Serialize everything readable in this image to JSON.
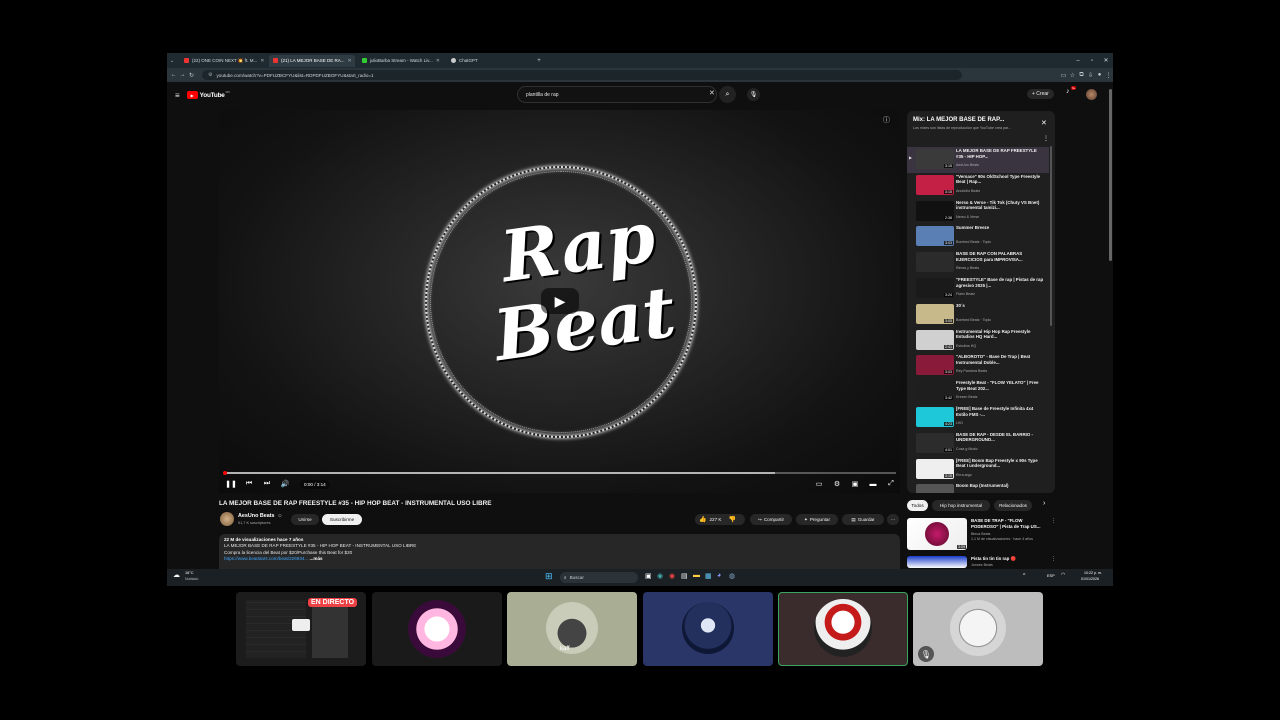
{
  "browser": {
    "tabs": [
      {
        "label": "(22) ONE COIN NEXT 💥 ft. M...",
        "color": "#e33"
      },
      {
        "label": "(21) LA MEJOR BASE DE RA...",
        "color": "#e33"
      },
      {
        "label": "julioBarba Stream - Watch Liv...",
        "color": "#3c3"
      },
      {
        "label": "ChatGPT",
        "color": "#ccc"
      }
    ],
    "new_tab": "+",
    "url": "youtube.com/watch?v=PDFUZBCFYU&list=RDPDFUZBOFYU&start_radio=1",
    "win_min": "–",
    "win_max": "▫",
    "win_close": "✕"
  },
  "youtube": {
    "logo": "YouTube",
    "logo_region": "MX",
    "search_value": "plantilla de rap",
    "create_label": "+ Crear",
    "notif_count": "9+"
  },
  "player": {
    "art_word1": "Rap",
    "art_word2": "Beat",
    "time": "0:00 / 3:14",
    "progress": 0.82
  },
  "video": {
    "title": "LA MEJOR BASE DE RAP FREESTYLE #35 - HIP HOP BEAT - INSTRUMENTAL USO LIBRE",
    "channel": "AesUno Beats",
    "subscribers": "51,7 K suscriptores",
    "join": "Unirse",
    "subscribe": "Suscribirme",
    "likes": "227 K",
    "share": "Compartir",
    "ask": "Preguntar",
    "save": "Guardar",
    "more": "···",
    "desc_stats": "22 M de visualizaciones  hace 7 años",
    "desc_line1": "LA MEJOR BASE DE RAP FREESTYLE #35 - HIP HOP BEAT - INSTRUMENTAL USO LIBRE",
    "desc_line2": "Compra la licencia del Beat por $20/Purchase this Beat for $20",
    "desc_link": "https://www.beatstars.com/beat/226934...",
    "desc_more": "...más"
  },
  "playlist": {
    "title": "Mix: LA MEJOR BASE DE RAP...",
    "subtitle": "Los mixes son listas de reproducción que YouTube crea par...",
    "close": "✕",
    "items": [
      {
        "title": "LA MEJOR BASE DE RAP FREESTYLE #35 - HIP HOP...",
        "channel": "AesUno Beats",
        "dur": "3:15",
        "color": "#3a3a3a"
      },
      {
        "title": "\"Versace\" 90s OldSchool Type Freestyle Beat | Rap...",
        "channel": "Anubidio Beatz",
        "dur": "3:15",
        "color": "#c42045"
      },
      {
        "title": "Nerso & Verse - Tik Tok (Chuty VS Bnet) instrumental tamizi...",
        "channel": "Nerso & Verse",
        "dur": "2:38",
        "color": "#111"
      },
      {
        "title": "Summer Breeze",
        "channel": "Bombed Beatz · Topic",
        "dur": "3:03",
        "color": "#5a7fb5"
      },
      {
        "title": "BASE DE RAP CON PALABRAS EJERCICIOS para IMPROVISA...",
        "channel": "Rimas y Beats",
        "dur": "",
        "color": "#2b2b2b"
      },
      {
        "title": "\"FREESTYLE\" Base de rap | Pistas de rap agresivo 2025 |...",
        "channel": "Flaim Beatz",
        "dur": "3:24",
        "color": "#1a1a1a"
      },
      {
        "title": "30´s",
        "channel": "Bombed Beatz · Topic",
        "dur": "3:05",
        "color": "#c8b98a"
      },
      {
        "title": "Instrumental Hip Hop Rap Freestyle Estudios HQ Hard...",
        "channel": "Estudios HQ",
        "dur": "2:41",
        "color": "#d0d0d0"
      },
      {
        "title": "\"ALBOROTO\" - Base De Trap | Beat Instrumental Doble...",
        "channel": "Rey Pandora Beats",
        "dur": "3:03",
        "color": "#8a1a3a"
      },
      {
        "title": "Freestyle Beat - \"FLOW YELATO\" | Free Type Beat 202...",
        "channel": "Krezen Beatz",
        "dur": "3:42",
        "color": "#1e1e1e"
      },
      {
        "title": "[FREE] Base de Freestyle Infinita 4x4 Estilo FMS -...",
        "channel": "LKD",
        "dur": "4:23",
        "color": "#1ec8d8"
      },
      {
        "title": "BASE DE RAP - DESDE EL BARRIO - UNDERGROUND...",
        "channel": "Cosa g Music",
        "dur": "4:01",
        "color": "#2c2c2c"
      },
      {
        "title": "[FREE] Boom Bap Freestyle x 90s Type Beat I underground...",
        "channel": "Elrra.argo",
        "dur": "3:15",
        "color": "#efefef"
      },
      {
        "title": "Boom Bap (Instrumental)",
        "channel": "",
        "dur": "",
        "color": "#555"
      }
    ]
  },
  "chips": [
    "Todos",
    "Hip hop instrumental",
    "Relacionados",
    "›"
  ],
  "related": [
    {
      "title": "BASE DE TRAP - \"FLOW PODEROSO\" | Pista de Trap US...",
      "channel": "Bteca Beats",
      "meta": "1,1 M de visualizaciones · hace 4 años",
      "dur": "3:09"
    },
    {
      "title": "Pista tin tin tin rap 🔴",
      "channel": "Jonnes Beats",
      "meta": "",
      "dur": ""
    }
  ],
  "taskbar": {
    "weather_temp": "16°C",
    "weather_text": "Nublado",
    "search": "Buscar",
    "lang": "ESP",
    "time": "10:22 p. m.",
    "date": "01/01/2026"
  },
  "call": {
    "live_badge": "EN DIRECTO",
    "tile_label": "kaff"
  }
}
